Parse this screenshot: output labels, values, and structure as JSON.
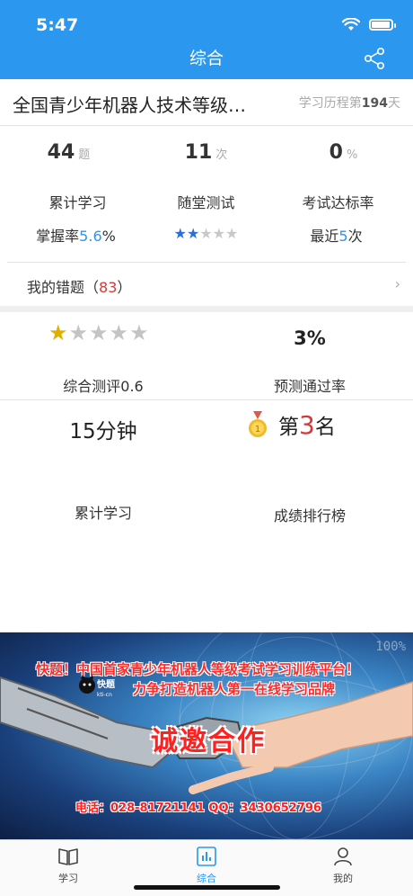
{
  "status_bar": {
    "time": "5:47",
    "battery_level": 0.95
  },
  "nav": {
    "title": "综合",
    "share_icon": "share-icon"
  },
  "course": {
    "title": "全国青少年机器人技术等级…",
    "history_prefix": "学习历程第",
    "history_days": "194",
    "history_suffix": "天"
  },
  "stats": [
    {
      "value": "44",
      "unit": "题",
      "label": "累计学习",
      "sub_prefix": "掌握率",
      "sub_value": "5.6",
      "sub_suffix": "%"
    },
    {
      "value": "11",
      "unit": "次",
      "label": "随堂测试",
      "rating": 1.5,
      "rating_max": 5
    },
    {
      "value": "0",
      "unit": "%",
      "label": "考试达标率",
      "sub_prefix": "最近",
      "sub_value": "5",
      "sub_suffix": "次"
    }
  ],
  "wrong_questions": {
    "label": "我的错题（",
    "count": "83",
    "close": "）"
  },
  "overview": {
    "rating": 0.5,
    "rating_max": 5,
    "rating_label": "综合测评0.6",
    "pass_rate": "3%",
    "pass_rate_label": "预测通过率",
    "study_time": "15分钟",
    "study_time_label": "累计学习",
    "rank_prefix": "第",
    "rank_value": "3",
    "rank_suffix": "名",
    "rank_label": "成绩排行榜",
    "medal_number": "1"
  },
  "banner": {
    "line1": "快题！中国首家青少年机器人等级考试学习训练平台！",
    "line2": "力争打造机器人第一在线学习品牌",
    "logo_text": "快题",
    "logo_sub": "kti-cn",
    "main": "诚邀合作",
    "contact": "电话：028-81721141 QQ：3430652796",
    "deco_pct": "100%"
  },
  "tabs": [
    {
      "label": "学习",
      "icon": "book-icon",
      "active": false
    },
    {
      "label": "综合",
      "icon": "bar-chart-icon",
      "active": true
    },
    {
      "label": "我的",
      "icon": "user-icon",
      "active": false
    }
  ],
  "colors": {
    "accent": "#2b97ee",
    "highlight": "#d23b3b",
    "star": "#2b6fd6"
  }
}
